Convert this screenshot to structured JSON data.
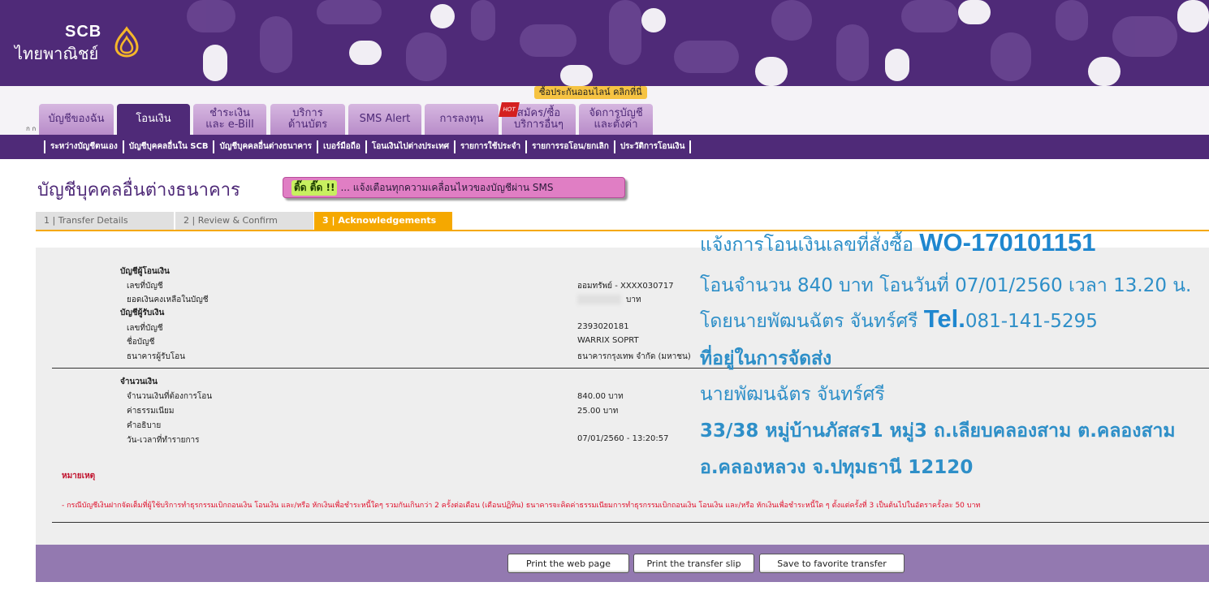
{
  "brand": {
    "name": "SCB",
    "thai_name": "ไทยพาณิชย์"
  },
  "promo_badge": "ซื้อประกันออนไลน์ คลิกที่นี่",
  "font_size_toggle": "ก ก",
  "tabs": [
    {
      "label": "บัญชีของฉัน"
    },
    {
      "label": "โอนเงิน",
      "active": true
    },
    {
      "label_line1": "ชำระเงิน",
      "label_line2": "และ e-Bill"
    },
    {
      "label_line1": "บริการ",
      "label_line2": "ด้านบัตร"
    },
    {
      "label": "SMS Alert"
    },
    {
      "label": "การลงทุน"
    },
    {
      "label_line1": "สมัคร/ซื้อ",
      "label_line2": "บริการอื่นๆ",
      "badge": "HOT"
    },
    {
      "label_line1": "จัดการบัญชี",
      "label_line2": "และตั้งค่า"
    }
  ],
  "subnav": [
    "ระหว่างบัญชีตนเอง",
    "บัญชีบุคคลอื่นใน SCB",
    "บัญชีบุคคลอื่นต่างธนาคาร",
    "เบอร์มือถือ",
    "โอนเงินไปต่างประเทศ",
    "รายการใช้ประจำ",
    "รายการรอโอน/ยกเลิก",
    "ประวัติการโอนเงิน"
  ],
  "page_title": "บัญชีบุคคลอื่นต่างธนาคาร",
  "sms_banner": {
    "highlight": "ติ๊ด ติ๊ด !!",
    "text": "... แจ้งเตือนทุกความเคลื่อนไหวของบัญชีผ่าน SMS"
  },
  "steps": [
    "1 | Transfer Details",
    "2 | Review & Confirm",
    "3 | Acknowledgements"
  ],
  "details": {
    "from_heading": "บัญชีผู้โอนเงิน",
    "from_account_label": "เลขที่บัญชี",
    "from_account_value": "ออมทรัพย์ - XXXX030717",
    "balance_label": "ยอดเงินคงเหลือในบัญชี",
    "balance_unit": "บาท",
    "to_heading": "บัญชีผู้รับเงิน",
    "to_account_label": "เลขที่บัญชี",
    "to_account_value": "2393020181",
    "to_name_label": "ชื่อบัญชี",
    "to_name_value": "WARRIX SOPRT",
    "to_bank_label": "ธนาคารผู้รับโอน",
    "to_bank_value": "ธนาคารกรุงเทพ จำกัด (มหาชน)",
    "amount_heading": "จำนวนเงิน",
    "amount_label": "จำนวนเงินที่ต้องการโอน",
    "amount_value": "840.00  บาท",
    "fee_label": "ค่าธรรมเนียม",
    "fee_value": "25.00  บาท",
    "memo_label": "คำอธิบาย",
    "datetime_label": "วัน-เวลาที่ทำรายการ",
    "datetime_value": "07/01/2560 - 13:20:57"
  },
  "remark_title": "หมายเหตุ",
  "remark_text": "- กรณีบัญชีเงินฝากจัดเต็มที่ผู้ใช้บริการทำธุรกรรมเบิกถอนเงิน โอนเงิน และ/หรือ หักเงินเพื่อชำระหนี้ใดๆ รวมกันเกินกว่า 2 ครั้งต่อเดือน (เดือนปฏิทิน) ธนาคารจะคิดค่าธรรมเนียมการทำธุรกรรมเบิกถอนเงิน โอนเงิน และ/หรือ หักเงินเพื่อชำระหนี้ใด ๆ ตั้งแต่ครั้งที่ 3 เป็นต้นไปในอัตราครั้งละ 50 บาท",
  "annotation": {
    "line1_text": "แจ้งการโอนเงินเลขที่สั่งซื้อ ",
    "line1_order": "WO-170101151",
    "line2": "โอนจำนวน 840 บาท โอนวันที่ 07/01/2560 เวลา 13.20 น.",
    "line3_text": "โดยนายพัฒนฉัตร จันทร์ศรี ",
    "line3_tel_label": "Tel.",
    "line3_tel": "081-141-5295",
    "line4": "ที่อยู่ในการจัดส่ง",
    "line5": "นายพัฒนฉัตร  จันทร์ศรี",
    "line6": "33/38 หมู่บ้านภัสสร1 หมู่3 ถ.เลียบคลองสาม ต.คลองสาม",
    "line7": "อ.คลองหลวง จ.ปทุมธานี 12120"
  },
  "buttons": {
    "print_page": "Print the web page",
    "print_slip": "Print the transfer slip",
    "save_favorite": "Save to favorite transfer"
  },
  "colors": {
    "brand_purple": "#4f2a78",
    "step_active": "#f5a800",
    "annotation_blue": "#2e8fc8"
  }
}
